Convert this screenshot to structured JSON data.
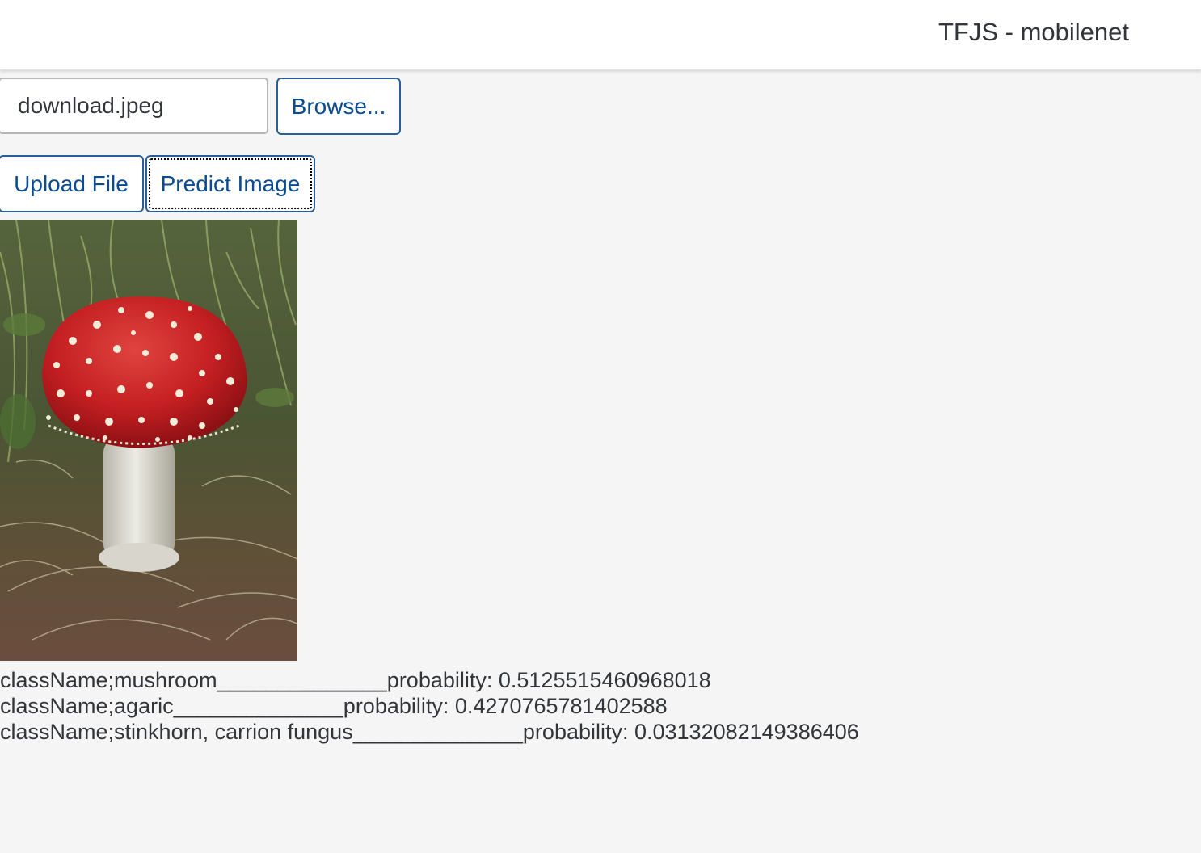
{
  "header": {
    "title": "TFJS - mobilenet"
  },
  "file_input": {
    "value": "download.jpeg",
    "browse_label": "Browse..."
  },
  "actions": {
    "upload_label": "Upload File",
    "predict_label": "Predict Image"
  },
  "preview_image": {
    "subject": "red mushroom with white spots"
  },
  "predictions": [
    {
      "text": "className;mushroom______________probability: 0.5125515460968018"
    },
    {
      "text": "className;agaric______________probability: 0.4270765781402588"
    },
    {
      "text": "className;stinkhorn, carrion fungus______________probability: 0.03132082149386406"
    }
  ],
  "colors": {
    "accent": "#0a4c94",
    "background": "#f5f5f5",
    "header": "#ffffff"
  }
}
